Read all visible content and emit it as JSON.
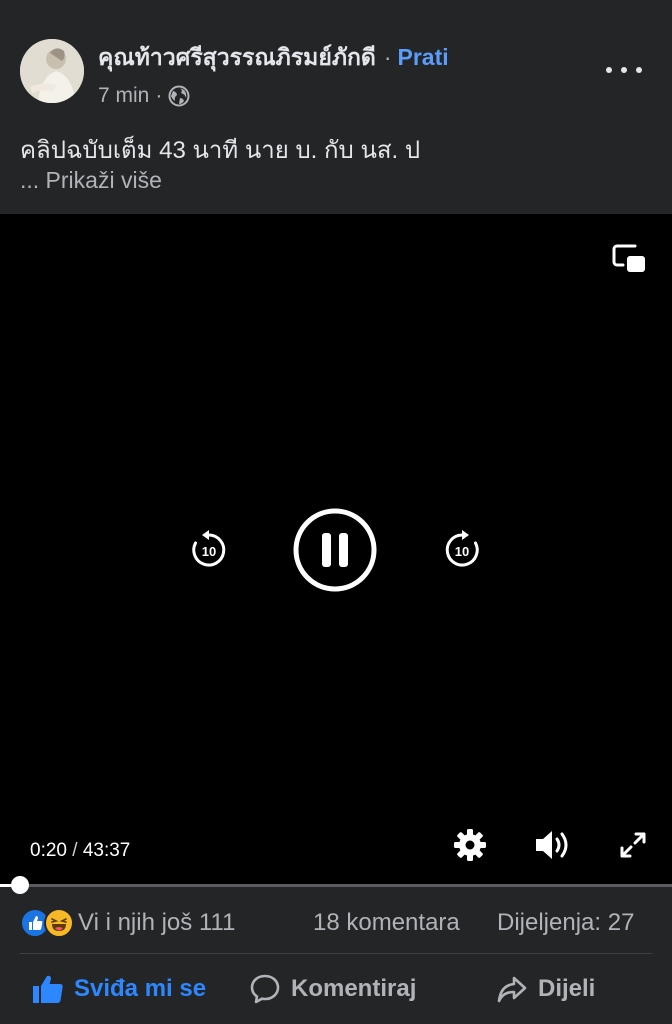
{
  "post": {
    "author": "คุณท้าวศรีสุวรรณภิรมย์ภักดี",
    "separator": "·",
    "follow_label": "Prati",
    "time_ago": "7 min",
    "meta_separator": "·",
    "privacy_icon": "globe-icon",
    "caption": "คลิปฉบับเต็ม 43 นาที นาย บ. กับ นส. ป",
    "see_more": "... Prikaži više"
  },
  "video": {
    "current_time": "0:20",
    "time_separator": "/",
    "duration": "43:37",
    "progress_fraction": 0.0077,
    "rewind_seconds": "10",
    "forward_seconds": "10",
    "icons": [
      "picture-in-picture-icon",
      "rewind-10-icon",
      "pause-icon",
      "forward-10-icon",
      "gear-icon",
      "volume-icon",
      "fullscreen-icon"
    ]
  },
  "stats": {
    "reactions_text": "Vi i njih još 111",
    "comments": "18 komentara",
    "shares": "Dijeljenja: 27"
  },
  "actions": {
    "like_label": "Sviđa mi se",
    "comment_label": "Komentiraj",
    "share_label": "Dijeli"
  },
  "colors": {
    "background": "#242526",
    "video_background": "#000000",
    "accent": "#2d88ff",
    "follow": "#5b9dfb",
    "muted_text": "#b0b3b8"
  }
}
